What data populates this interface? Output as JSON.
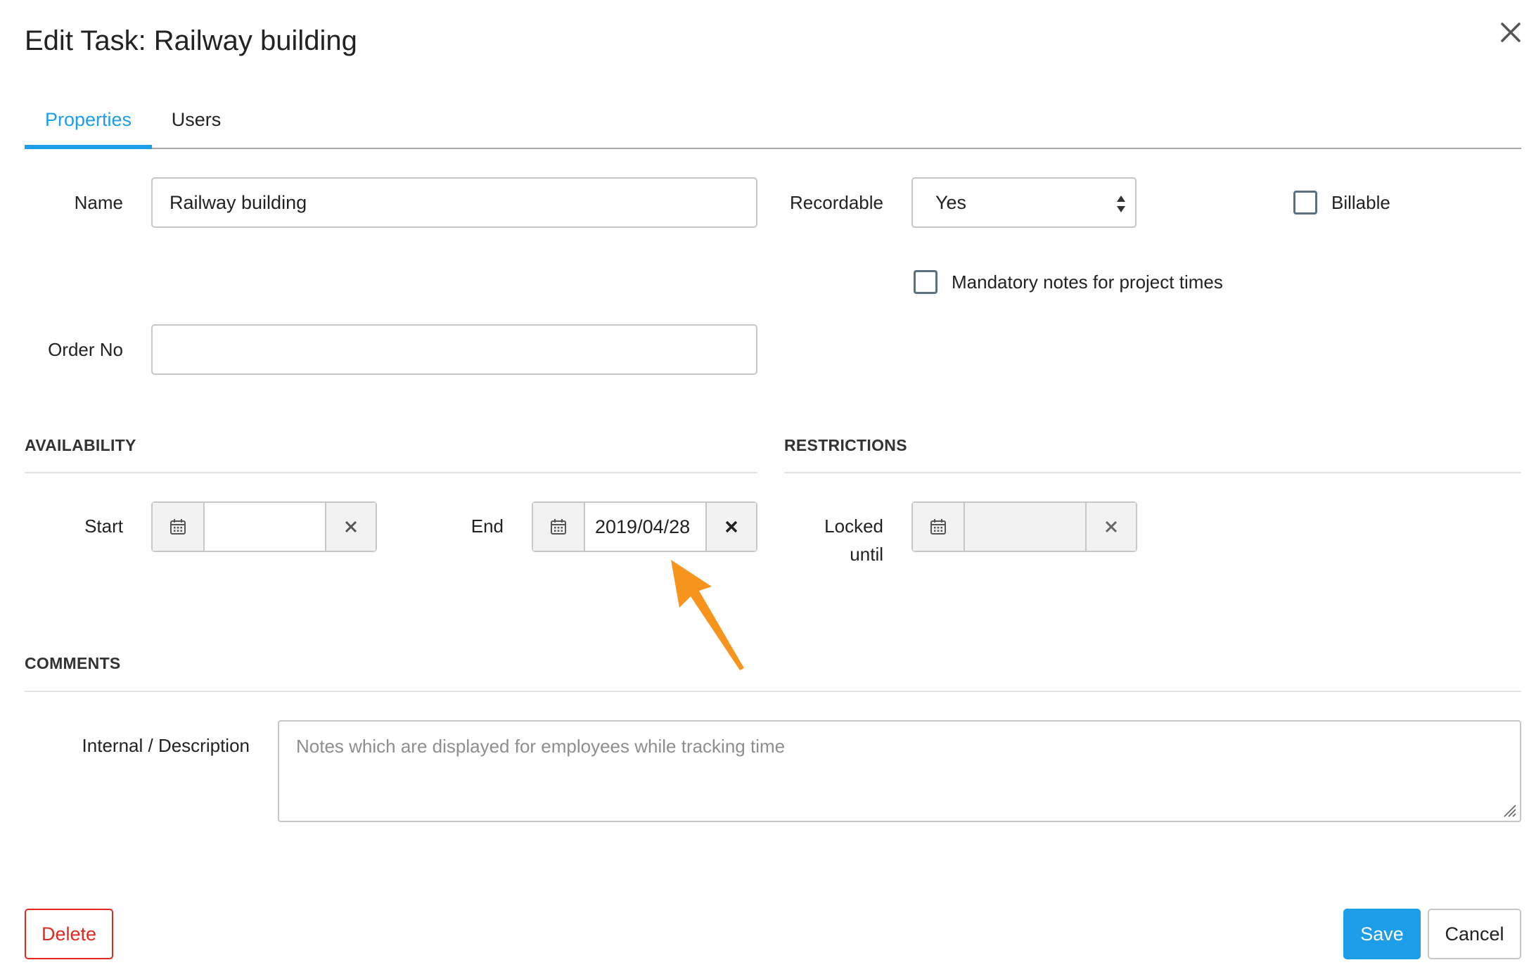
{
  "dialog": {
    "title": "Edit Task: Railway building",
    "close_icon": "close-icon"
  },
  "tabs": [
    {
      "label": "Properties",
      "active": true
    },
    {
      "label": "Users",
      "active": false
    }
  ],
  "colors": {
    "accent": "#1e9ee8",
    "danger": "#e3281e",
    "annotation_arrow": "#f7941d"
  },
  "form": {
    "name": {
      "label": "Name",
      "value": "Railway building"
    },
    "recordable": {
      "label": "Recordable",
      "value": "Yes"
    },
    "billable": {
      "label": "Billable",
      "checked": false
    },
    "mandatory_notes": {
      "label": "Mandatory notes for project times",
      "checked": false
    },
    "order_no": {
      "label": "Order No",
      "value": ""
    }
  },
  "availability": {
    "heading": "AVAILABILITY",
    "start": {
      "label": "Start",
      "value": ""
    },
    "end": {
      "label": "End",
      "value": "2019/04/28"
    }
  },
  "restrictions": {
    "heading": "RESTRICTIONS",
    "locked_until": {
      "label_line1": "Locked",
      "label_line2": "until",
      "value": ""
    }
  },
  "comments": {
    "heading": "COMMENTS",
    "description": {
      "label": "Internal / Description",
      "placeholder": "Notes which are displayed for employees while tracking time",
      "value": ""
    }
  },
  "footer": {
    "delete_label": "Delete",
    "save_label": "Save",
    "cancel_label": "Cancel"
  }
}
